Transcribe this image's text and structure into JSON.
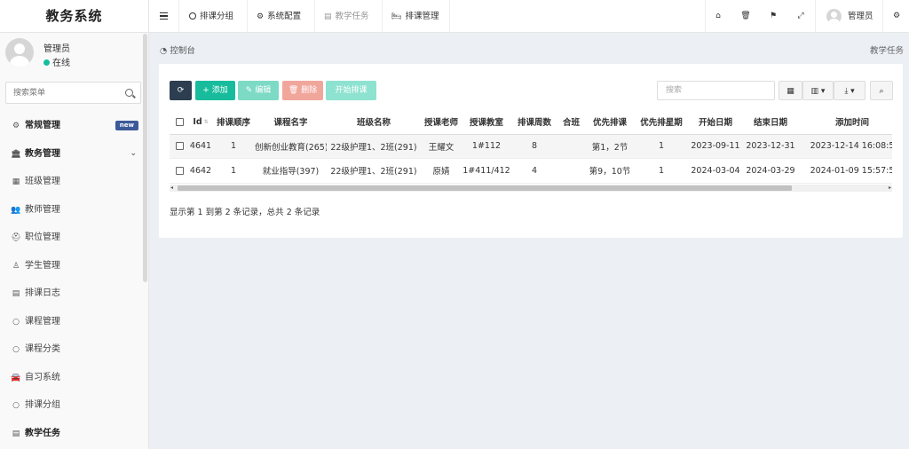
{
  "sidebar": {
    "logo": "教务系统",
    "user": {
      "name": "管理员",
      "status": "在线"
    },
    "search_placeholder": "搜索菜单",
    "items": [
      {
        "label": "常规管理",
        "badge": "new",
        "bold": true
      },
      {
        "label": "教务管理",
        "bold": true
      },
      {
        "label": "班级管理"
      },
      {
        "label": "教师管理"
      },
      {
        "label": "职位管理"
      },
      {
        "label": "学生管理"
      },
      {
        "label": "排课日志"
      },
      {
        "label": "课程管理"
      },
      {
        "label": "课程分类"
      },
      {
        "label": "自习系统"
      },
      {
        "label": "排课分组"
      },
      {
        "label": "教学任务",
        "bold": true
      }
    ]
  },
  "topnav": {
    "tabs": [
      {
        "label": "排课分组"
      },
      {
        "label": "系统配置"
      },
      {
        "label": "教学任务"
      },
      {
        "label": "排课管理"
      }
    ],
    "user_name": "管理员"
  },
  "breadcrumb": {
    "left": "控制台",
    "right": "教学任务"
  },
  "toolbar": {
    "add": "添加",
    "edit": "编辑",
    "delete": "删除",
    "start": "开始排课",
    "search_placeholder": "搜索"
  },
  "table": {
    "columns": [
      "Id",
      "排课顺序",
      "课程名字",
      "班级名称",
      "授课老师",
      "授课教室",
      "排课周数",
      "合班",
      "优先排课",
      "优先排星期",
      "开始日期",
      "结束日期",
      "添加时间"
    ],
    "rows": [
      [
        "4641",
        "1",
        "创新创业教育(265)",
        "22级护理1、2班(291)",
        "王耀文",
        "1#112",
        "8",
        "",
        "第1，2节",
        "1",
        "2023-09-11",
        "2023-12-31",
        "2023-12-14 16:08:5"
      ],
      [
        "4642",
        "1",
        "就业指导(397)",
        "22级护理1、2班(291)",
        "原婧",
        "1#411/412",
        "4",
        "",
        "第9，10节",
        "1",
        "2024-03-04",
        "2024-03-29",
        "2024-01-09 15:57:5"
      ]
    ]
  },
  "pagination": {
    "info": "显示第 1 到第 2 条记录，总共 2 条记录"
  },
  "colors": {
    "accent": "#18bc9c",
    "dark": "#2c3e50",
    "badge": "#3c5a9a"
  }
}
